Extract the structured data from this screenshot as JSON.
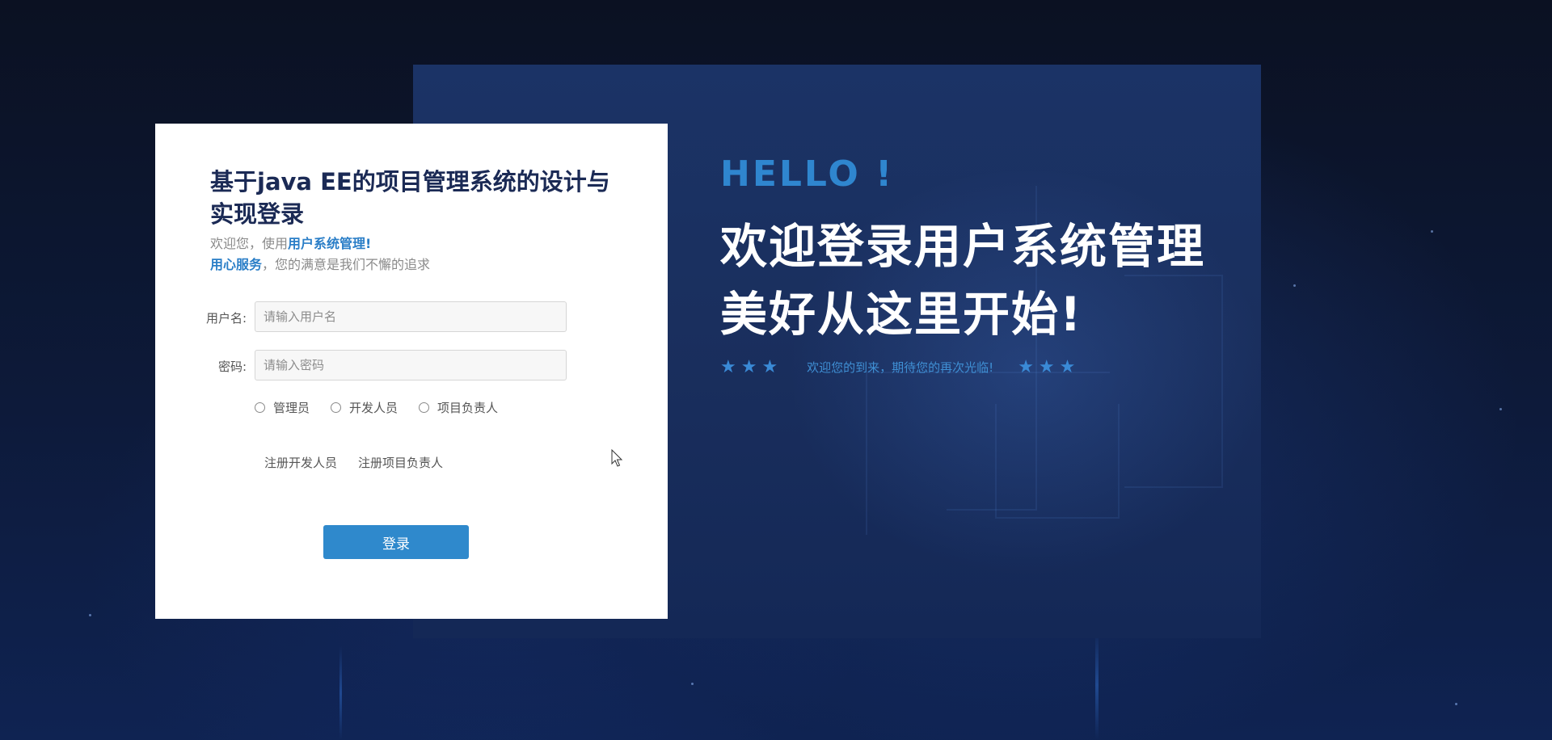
{
  "page": {
    "title": "基于java EE的项目管理系统的设计与实现登录"
  },
  "login_card": {
    "title": "基于java EE的项目管理系统的设计与实现登录",
    "welcome_line1_prefix": "欢迎您，使用",
    "welcome_line1_highlight": "用户系统管理!",
    "welcome_line2_highlight": "用心服务",
    "welcome_line2_suffix": "，您的满意是我们不懈的追求",
    "username_label": "用户名:",
    "username_placeholder": "请输入用户名",
    "username_value": "",
    "password_label": "密码:",
    "password_placeholder": "请输入密码",
    "password_value": "",
    "roles": [
      {
        "label": "管理员",
        "selected": false
      },
      {
        "label": "开发人员",
        "selected": false
      },
      {
        "label": "项目负责人",
        "selected": false
      }
    ],
    "register_developer_label": "注册开发人员",
    "register_manager_label": "注册项目负责人",
    "login_button_label": "登录"
  },
  "hero": {
    "hello": "HELLO !",
    "headline_line1": "欢迎登录用户系统管理",
    "headline_line2": "美好从这里开始!",
    "stars_left": "★★★",
    "tagline": "欢迎您的到来，期待您的再次光临!",
    "stars_right": "★★★"
  },
  "colors": {
    "accent_blue": "#2f89cc",
    "title_navy": "#1b2a55",
    "hello_blue": "#2f86cf",
    "hero_bg": "#1a2f5e"
  },
  "icons": {
    "cursor": "mouse-pointer-icon",
    "star": "star-icon"
  }
}
